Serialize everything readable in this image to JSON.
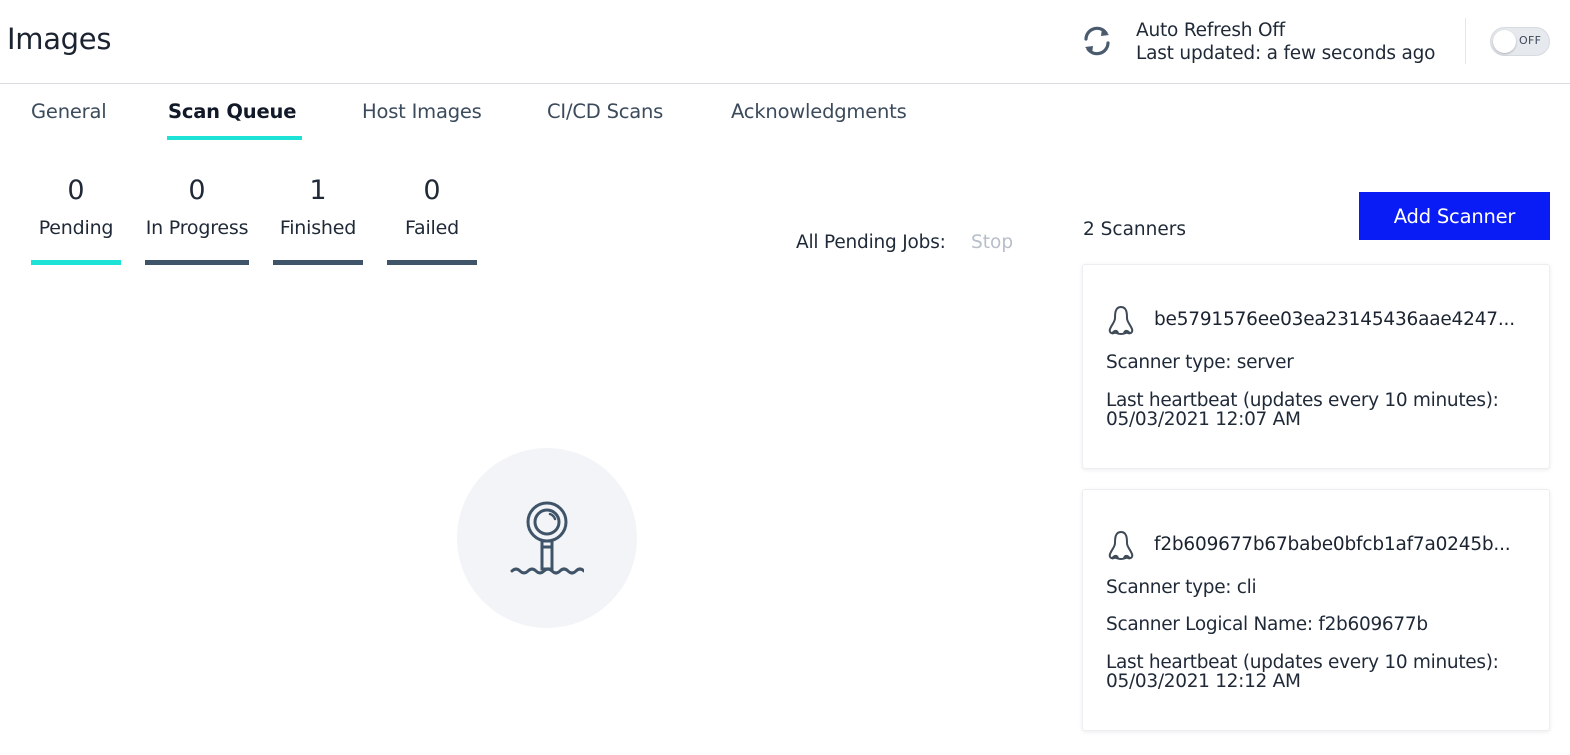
{
  "header": {
    "title": "Images",
    "refresh_icon": "refresh-icon",
    "auto_refresh_label": "Auto Refresh Off",
    "last_updated": "Last updated: a few seconds ago",
    "toggle_label": "OFF"
  },
  "tabs": [
    {
      "label": "General",
      "active": false
    },
    {
      "label": "Scan Queue",
      "active": true
    },
    {
      "label": "Host Images",
      "active": false
    },
    {
      "label": "CI/CD Scans",
      "active": false
    },
    {
      "label": "Acknowledgments",
      "active": false
    }
  ],
  "stats": [
    {
      "value": "0",
      "label": "Pending",
      "active": true
    },
    {
      "value": "0",
      "label": "In Progress",
      "active": false
    },
    {
      "value": "1",
      "label": "Finished",
      "active": false
    },
    {
      "value": "0",
      "label": "Failed",
      "active": false
    }
  ],
  "jobs": {
    "label_prefix": "All",
    "label_highlight": "Pending",
    "label_suffix": "Jobs:",
    "stop_label": "Stop"
  },
  "empty_state": {
    "icon": "periscope-icon"
  },
  "scanners": {
    "count_label": "2 Scanners",
    "add_button_label": "Add Scanner",
    "items": [
      {
        "icon": "linux-icon",
        "id": "be5791576ee03ea23145436aae4247...",
        "type_line": "Scanner type: server",
        "heartbeat_label": "Last heartbeat (updates every 10 minutes):",
        "heartbeat_time": "05/03/2021 12:07 AM"
      },
      {
        "icon": "linux-icon",
        "id": "f2b609677b67babe0bfcb1af7a0245b...",
        "type_line": "Scanner type: cli",
        "logical_name_line": "Scanner Logical Name: f2b609677b",
        "heartbeat_label": "Last heartbeat (updates every 10 minutes):",
        "heartbeat_time": "05/03/2021 12:12 AM"
      }
    ]
  },
  "colors": {
    "accent": "#1de2d6",
    "primary_button": "#0a1cf5",
    "inactive_bar": "#3f5468"
  }
}
